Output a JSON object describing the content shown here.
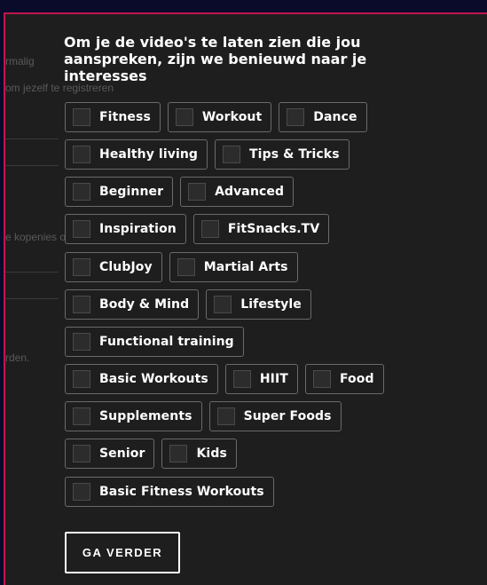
{
  "background_hints": [
    "rmalig",
    "om jezelf te registreren",
    "e kopenies op",
    "rden."
  ],
  "title": "Om je de video's te laten zien die jou aanspreken, zijn we benieuwd naar je interesses",
  "rows": [
    [
      "Fitness",
      "Workout",
      "Dance"
    ],
    [
      "Healthy living",
      "Tips & Tricks"
    ],
    [
      "Beginner",
      "Advanced"
    ],
    [
      "Inspiration",
      "FitSnacks.TV"
    ],
    [
      "ClubJoy",
      "Martial Arts"
    ],
    [
      "Body & Mind",
      "Lifestyle"
    ],
    [
      "Functional training"
    ],
    [
      "Basic Workouts",
      "HIIT",
      "Food"
    ],
    [
      "Supplements",
      "Super Foods"
    ],
    [
      "Senior",
      "Kids"
    ],
    [
      "Basic Fitness Workouts"
    ]
  ],
  "continue_button": "GA VERDER",
  "colors": {
    "accent_border": "#c0164e",
    "panel": "#1e1e1e",
    "text": "#ffffff"
  }
}
